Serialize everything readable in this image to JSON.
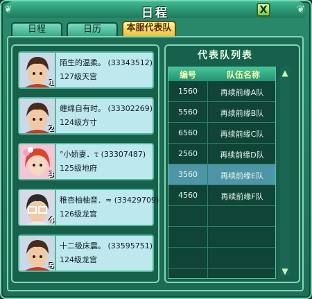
{
  "window": {
    "title": "日程",
    "close_label": "X"
  },
  "tabs": [
    {
      "label": "日程",
      "active": false
    },
    {
      "label": "日历",
      "active": false
    },
    {
      "label": "本服代表队",
      "active": true
    }
  ],
  "members": [
    {
      "name": "陌生的温柔。",
      "id": "(33343512)",
      "level_school": "127级天宫",
      "rank": "1"
    },
    {
      "name": "缠绵自有时。",
      "id": "(33302269)",
      "level_school": "124级方寸",
      "rank": "2"
    },
    {
      "name": "°小娇妻．τ",
      "id": "(33307487)",
      "level_school": "125级地府",
      "rank": "3"
    },
    {
      "name": "稚杏柚柚音．≈",
      "id": "(33429709)",
      "level_school": "126级龙宫",
      "rank": "4"
    },
    {
      "name": "十二级床震。",
      "id": "(33595751)",
      "level_school": "124级龙宫",
      "rank": "5"
    }
  ],
  "team_list": {
    "title": "代表队列表",
    "headers": {
      "number": "编号",
      "name": "队伍名称"
    },
    "rows": [
      {
        "number": "1560",
        "name": "再续前缘A队",
        "selected": false
      },
      {
        "number": "5560",
        "name": "再续前缘B队",
        "selected": false
      },
      {
        "number": "6560",
        "name": "再续前缘C队",
        "selected": false
      },
      {
        "number": "2560",
        "name": "再续前缘D队",
        "selected": false
      },
      {
        "number": "3560",
        "name": "再续前缘E队",
        "selected": true
      },
      {
        "number": "4560",
        "name": "再续前缘F队",
        "selected": false
      }
    ]
  },
  "icons": {
    "scroll_up": "scroll-up-icon",
    "scroll_down": "scroll-down-icon",
    "close": "close-icon"
  },
  "colors": {
    "frame": "#1f6e57",
    "active_tab": "#e8c23c",
    "selected_row": "#4f95a8"
  }
}
